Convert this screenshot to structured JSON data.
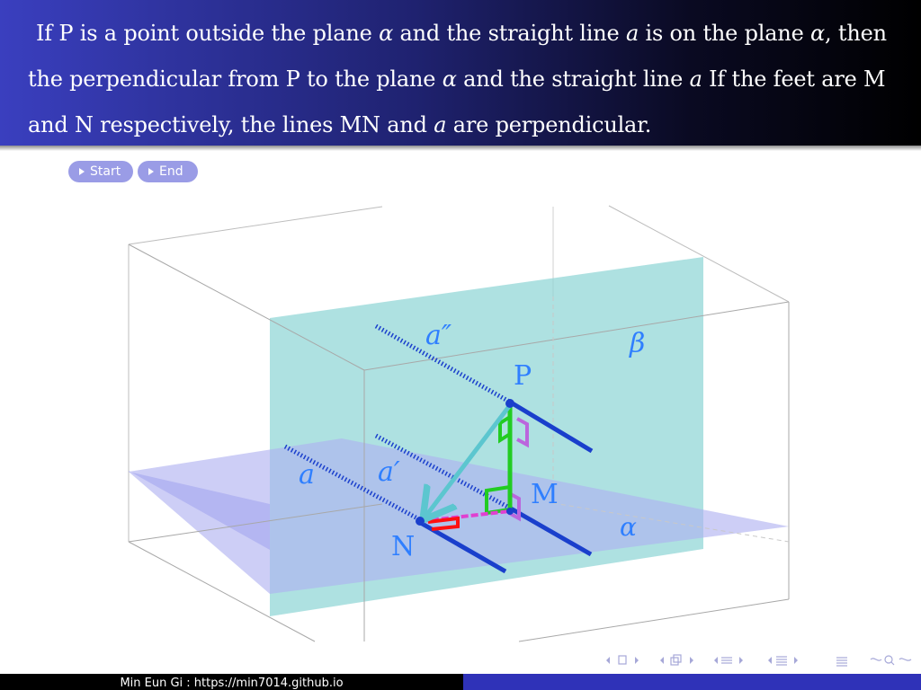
{
  "problem": {
    "part1": "If P is a point outside the plane ",
    "alpha1": "α",
    "part2": " and the straight line ",
    "a1": "a",
    "part3": " is on the plane ",
    "alpha2": "α",
    "part4": ", then the perpendicular from P to the plane ",
    "alpha3": "α",
    "part5": " and the straight line ",
    "a2": "a",
    "part6": " If the feet are M and N respectively, the lines MN and ",
    "a3": "a",
    "part7": " are perpendicular."
  },
  "controls": {
    "start_label": "Start",
    "end_label": "End"
  },
  "labels": {
    "P": "P",
    "M": "M",
    "N": "N",
    "a": "a",
    "a_prime": "a′",
    "a_double_prime": "a″",
    "alpha": "α",
    "beta": "β"
  },
  "colors": {
    "plane_alpha": "#aeb0f0",
    "plane_beta": "#8fd6d6",
    "line_a": "#1a3fcc",
    "perp_PM": "#22cc22",
    "arrow_PN": "#5cc6cf",
    "seg_MN": "#e040d0",
    "right_angle_N": "#ff0000",
    "right_angle_P": "#bb66dd",
    "label": "#2f7fff"
  },
  "nav_icons": [
    "nav-slide-icon",
    "nav-frame-icon",
    "nav-subsection-icon",
    "nav-section-icon",
    "nav-toc-icon",
    "nav-search-icon"
  ],
  "footer": {
    "author": "Min Eun Gi : https://min7014.github.io"
  }
}
